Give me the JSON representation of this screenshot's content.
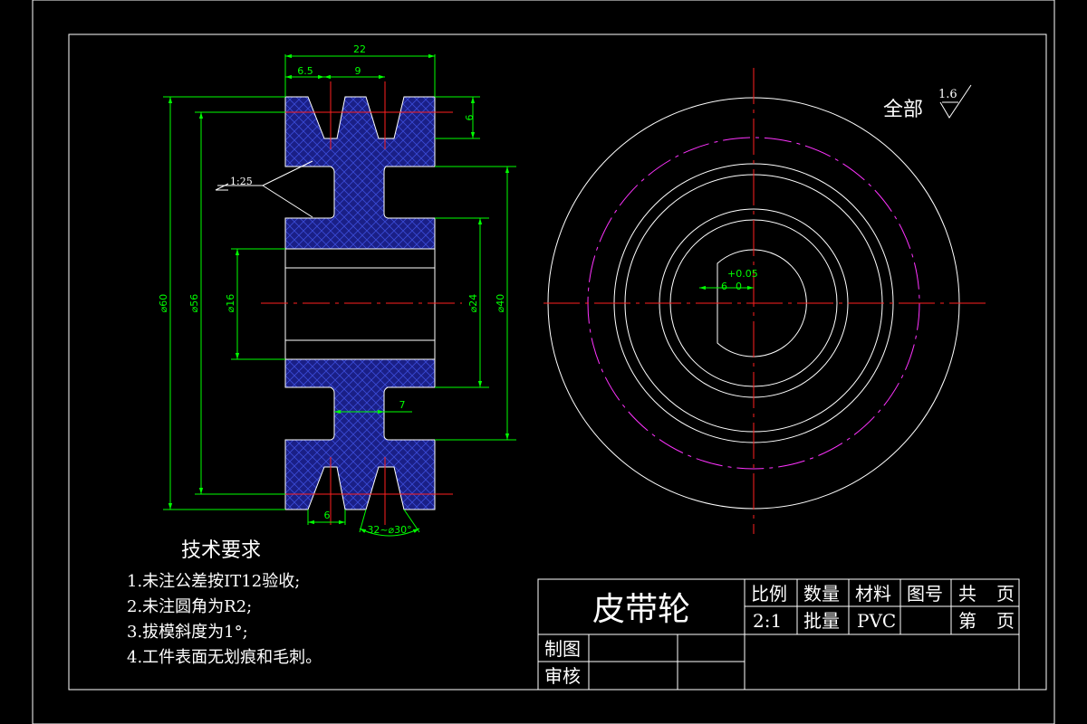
{
  "drawing": {
    "title": "皮带轮",
    "roughness": {
      "prefix": "全部",
      "value": "1.6"
    }
  },
  "dimensions": {
    "overall_width": "22",
    "groove_offset": "6.5",
    "groove_pitch": "9",
    "groove_depth": "6",
    "groove_taper": "1:25",
    "dia_outer": "⌀60",
    "dia_pitch": "⌀56",
    "dia_bore": "⌀16",
    "dia_hub": "⌀24",
    "dia_rim_inner": "⌀40",
    "web_width": "7",
    "groove_width": "6",
    "groove_angle": "32~⌀30°",
    "keyway_width": "6",
    "keyway_tol_upper": "+0.05",
    "keyway_tol_lower": "0"
  },
  "tech_requirements": {
    "heading": "技术要求",
    "items": [
      "1.未注公差按IT12验收;",
      "2.未注圆角为R2;",
      "3.拔模斜度为1°;",
      "4.工件表面无划痕和毛刺。"
    ]
  },
  "title_block": {
    "scale_label": "比例",
    "scale_value": "2:1",
    "qty_label": "数量",
    "batch_label": "批量",
    "material_label": "材料",
    "material_value": "PVC",
    "drawing_no_label": "图号",
    "total_label": "共",
    "page_unit": "页",
    "sheet_label": "第",
    "drawn_label": "制图",
    "checked_label": "审核"
  }
}
